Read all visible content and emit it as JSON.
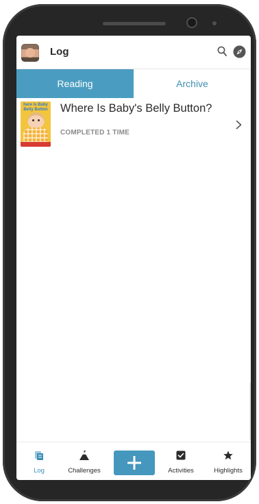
{
  "header": {
    "title": "Log",
    "avatar_icon": "user-avatar",
    "search_icon": "search-icon",
    "explore_icon": "compass-icon"
  },
  "tabs": [
    {
      "label": "Reading",
      "active": true
    },
    {
      "label": "Archive",
      "active": false
    }
  ],
  "books": [
    {
      "cover_text": "here is Baby Belly Button",
      "title": "Where Is Baby's Belly Button?",
      "status": "COMPLETED 1 TIME"
    }
  ],
  "bottom_nav": {
    "items": [
      {
        "label": "Log",
        "icon": "log-icon",
        "active": true
      },
      {
        "label": "Challenges",
        "icon": "mountain-icon",
        "active": false
      },
      {
        "label": "Activities",
        "icon": "checkbox-icon",
        "active": false
      },
      {
        "label": "Highlights",
        "icon": "star-icon",
        "active": false
      }
    ],
    "add_icon": "plus-icon"
  },
  "colors": {
    "accent": "#4a9dc0",
    "active_nav": "#3d8fb6",
    "phone_body": "#262626"
  }
}
